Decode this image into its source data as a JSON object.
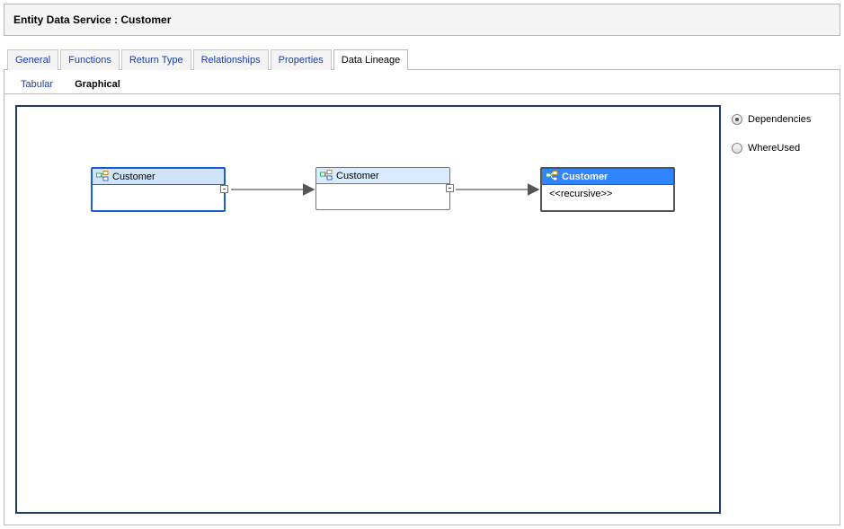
{
  "header": {
    "title": "Entity Data Service : Customer"
  },
  "tabs": {
    "primary": [
      {
        "label": "General",
        "active": false
      },
      {
        "label": "Functions",
        "active": false
      },
      {
        "label": "Return Type",
        "active": false
      },
      {
        "label": "Relationships",
        "active": false
      },
      {
        "label": "Properties",
        "active": false
      },
      {
        "label": "Data Lineage",
        "active": true
      }
    ],
    "secondary": [
      {
        "label": "Tabular",
        "active": false
      },
      {
        "label": "Graphical",
        "active": true
      }
    ]
  },
  "side": {
    "options": [
      {
        "label": "Dependencies",
        "checked": true
      },
      {
        "label": "WhereUsed",
        "checked": false
      }
    ]
  },
  "nodes": {
    "n1": {
      "label": "Customer",
      "body": ""
    },
    "n2": {
      "label": "Customer",
      "body": ""
    },
    "n3": {
      "label": "Customer",
      "body": "<<recursive>>"
    }
  }
}
